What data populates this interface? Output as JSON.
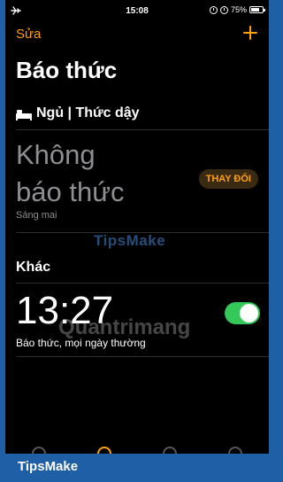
{
  "status_bar": {
    "time": "15:08",
    "battery": "75%",
    "battery_level": 0.75
  },
  "nav": {
    "edit_label": "Sửa"
  },
  "title": "Báo thức",
  "sleep": {
    "header": "Ngủ | Thức dậy",
    "status_line1": "Không",
    "status_line2": "báo thức",
    "subtitle": "Sáng mai",
    "change_button": "THAY ĐỔI"
  },
  "other": {
    "header": "Khác",
    "alarms": [
      {
        "time": "13:27",
        "label": "Báo thức, mọi ngày thường",
        "enabled": true
      }
    ]
  },
  "watermarks": {
    "top": "TipsMake",
    "bottom": "Quantrimang"
  },
  "footer_brand": "TipsMake",
  "colors": {
    "accent": "#ff9f0a",
    "toggle_on": "#34c759",
    "frame": "#1f5fa6"
  }
}
